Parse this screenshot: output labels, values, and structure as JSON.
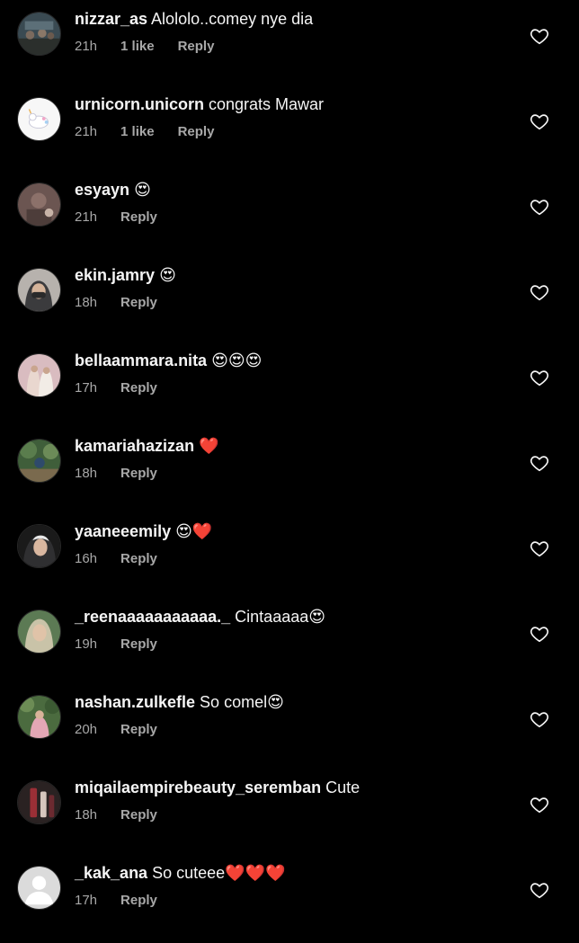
{
  "comments": [
    {
      "username": "nizzar_as",
      "text": " Alololo..comey nye dia",
      "emoji": "",
      "time": "21h",
      "likes": "1 like",
      "reply": "Reply",
      "avatar_color": "#3a4a52"
    },
    {
      "username": "urnicorn.unicorn",
      "text": " congrats Mawar",
      "emoji": "",
      "time": "21h",
      "likes": "1 like",
      "reply": "Reply",
      "avatar_color": "#f4f4f4"
    },
    {
      "username": "esyayn",
      "text": " ",
      "emoji": "😍",
      "time": "21h",
      "likes": "",
      "reply": "Reply",
      "avatar_color": "#6b5551"
    },
    {
      "username": "ekin.jamry",
      "text": " ",
      "emoji": "😍",
      "time": "18h",
      "likes": "",
      "reply": "Reply",
      "avatar_color": "#b7b2ad"
    },
    {
      "username": "bellaammara.nita",
      "text": " ",
      "emoji": "😍😍😍",
      "time": "17h",
      "likes": "",
      "reply": "Reply",
      "avatar_color": "#d9bcc0"
    },
    {
      "username": "kamariahazizan",
      "text": " ",
      "emoji": "❤️",
      "time": "18h",
      "likes": "",
      "reply": "Reply",
      "avatar_color": "#3f5e3a"
    },
    {
      "username": "yaaneeemily",
      "text": " ",
      "emoji": "😍❤️",
      "time": "16h",
      "likes": "",
      "reply": "Reply",
      "avatar_color": "#1a1a1a"
    },
    {
      "username": "_reenaaaaaaaaaaa._",
      "text": " Cintaaaaa",
      "emoji": "😍",
      "time": "19h",
      "likes": "",
      "reply": "Reply",
      "avatar_color": "#5c7a54"
    },
    {
      "username": "nashan.zulkefle",
      "text": " So comel",
      "emoji": "😍",
      "time": "20h",
      "likes": "",
      "reply": "Reply",
      "avatar_color": "#4b6b3f"
    },
    {
      "username": "miqailaempirebeauty_seremban",
      "text": " Cute",
      "emoji": "",
      "time": "18h",
      "likes": "",
      "reply": "Reply",
      "avatar_color": "#2a2222"
    },
    {
      "username": "_kak_ana",
      "text": " So cuteee",
      "emoji": "❤️❤️❤️",
      "time": "17h",
      "likes": "",
      "reply": "Reply",
      "avatar_color": "#dbdbdb"
    }
  ],
  "colors": {
    "background": "#000000",
    "text_primary": "#f5f5f5",
    "text_secondary": "#a8a8a8",
    "heart_love": "#ed4956"
  }
}
